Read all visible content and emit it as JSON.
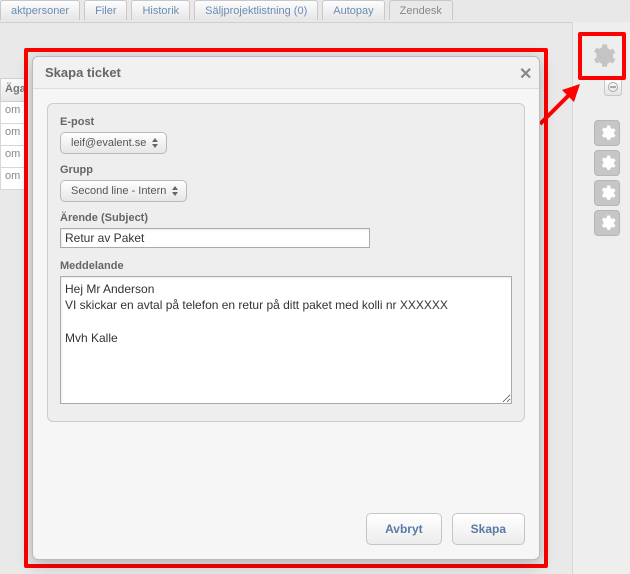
{
  "tabs": {
    "items": [
      {
        "label": "aktpersoner"
      },
      {
        "label": "Filer"
      },
      {
        "label": "Historik"
      },
      {
        "label": "Säljprojektlistning (0)"
      },
      {
        "label": "Autopay"
      },
      {
        "label": "Zendesk",
        "active": true
      }
    ]
  },
  "bg_table": {
    "header": "Ägar",
    "rows": [
      "om",
      "om",
      "om",
      "om"
    ]
  },
  "modal": {
    "title": "Skapa ticket",
    "email_label": "E-post",
    "email_value": "leif@evalent.se",
    "group_label": "Grupp",
    "group_value": "Second line - Intern",
    "subject_label": "Ärende (Subject)",
    "subject_value": "Retur av Paket",
    "message_label": "Meddelande",
    "message_value": "Hej Mr Anderson\nVI skickar en avtal på telefon en retur på ditt paket med kolli nr XXXXXX\n\nMvh Kalle",
    "cancel_label": "Avbryt",
    "create_label": "Skapa"
  }
}
